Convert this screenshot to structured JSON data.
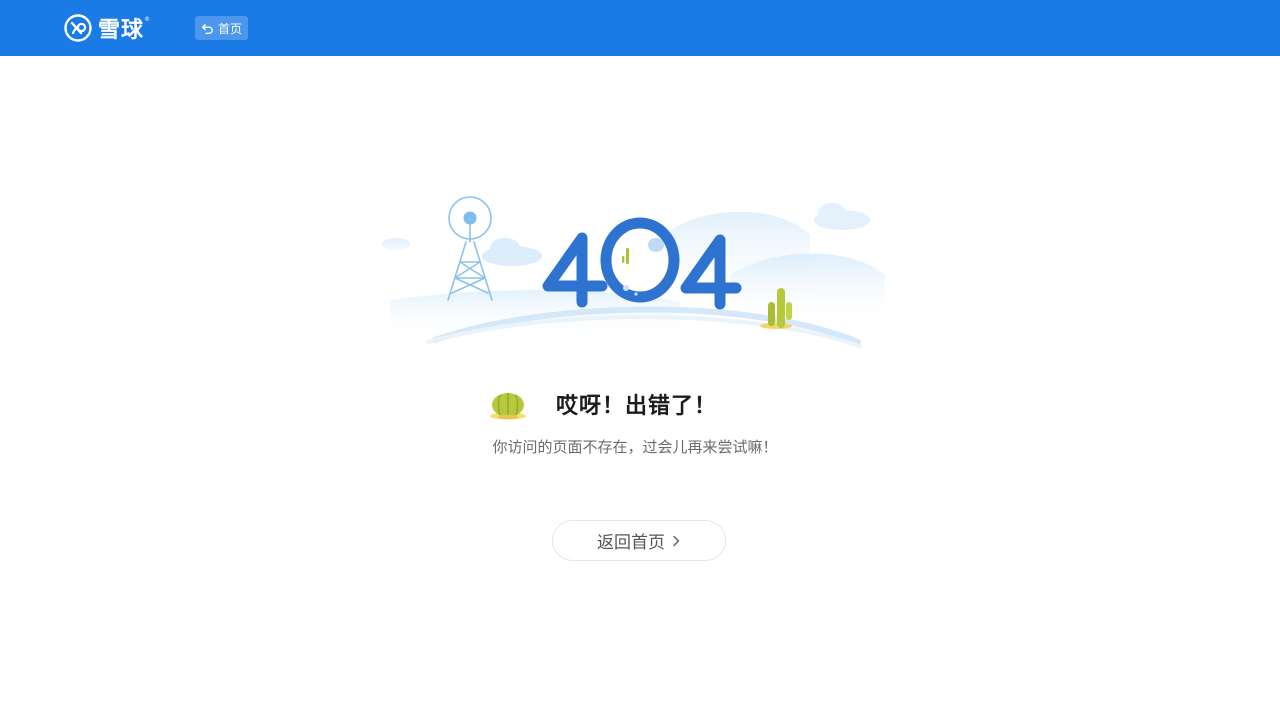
{
  "header": {
    "brand": "雪球",
    "brand_mark": "®",
    "home_label": "首页",
    "home_icon": "undo-arrow-icon"
  },
  "error": {
    "code": "404",
    "title": "哎呀！出错了！",
    "description": "你访问的页面不存在，过会儿再来尝试嘛！",
    "back_label": "返回首页",
    "back_icon": "chevron-right-icon"
  },
  "colors": {
    "brand_blue": "#1a7ae6",
    "code_blue": "#2e6fd0",
    "cactus_green": "#b8c93a"
  }
}
